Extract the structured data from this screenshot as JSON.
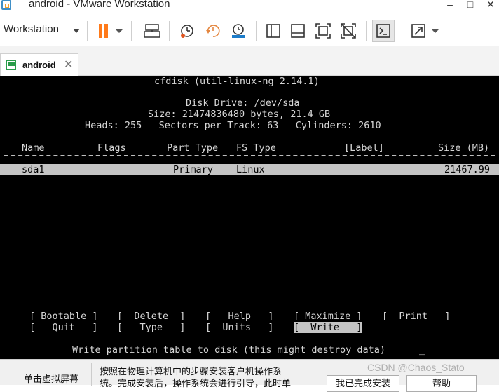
{
  "window": {
    "title": "android - VMware Workstation",
    "minimize": "–",
    "maximize": "□",
    "close": "✕"
  },
  "toolbar": {
    "menu_label": "Workstation",
    "icons": [
      "pause-icon",
      "pause-dropdown-icon",
      "send-ctrl-alt-del-icon",
      "snapshot-take-icon",
      "snapshot-revert-icon",
      "snapshot-manager-icon",
      "library-view-icon",
      "thumbnail-bar-icon",
      "fit-guest-icon",
      "unity-icon",
      "console-view-icon",
      "fullscreen-icon",
      "fullscreen-dropdown-icon"
    ]
  },
  "tab": {
    "label": "android",
    "close": "✕"
  },
  "cfdisk": {
    "header": "cfdisk (util-linux-ng 2.14.1)",
    "disk_drive": "Disk Drive: /dev/sda",
    "size_line": "Size: 21474836480 bytes, 21.4 GB",
    "geometry_line": "Heads: 255   Sectors per Track: 63   Cylinders: 2610",
    "columns": {
      "name": "Name",
      "flags": "Flags",
      "part_type": "Part Type",
      "fs_type": "FS Type",
      "label": "[Label]",
      "size": "Size (MB)"
    },
    "partitions": [
      {
        "name": "sda1",
        "flags": "",
        "part_type": "Primary",
        "fs_type": "Linux",
        "label": "",
        "size": "21467.99"
      }
    ],
    "menu_row1": [
      "[ Bootable ]",
      "[  Delete  ]",
      "[   Help   ]",
      "[ Maximize ]",
      "[  Print   ]"
    ],
    "menu_row2": [
      "[   Quit   ]",
      "[   Type   ]",
      "[  Units   ]",
      "[  Write   ]"
    ],
    "selected_menu": "[  Write   ]",
    "status": "Write partition table to disk (this might destroy data)",
    "cursor": "_"
  },
  "bottom": {
    "hint_left": "单击虚拟屏幕",
    "hint_main_line1": "按照在物理计算机中的步骤安装客户机操作系",
    "hint_main_line2": "统。完成安装后，操作系统会进行引导，此时单",
    "done_button": "我已完成安装",
    "help_button": "帮助"
  },
  "watermark": "CSDN @Chaos_Stato"
}
